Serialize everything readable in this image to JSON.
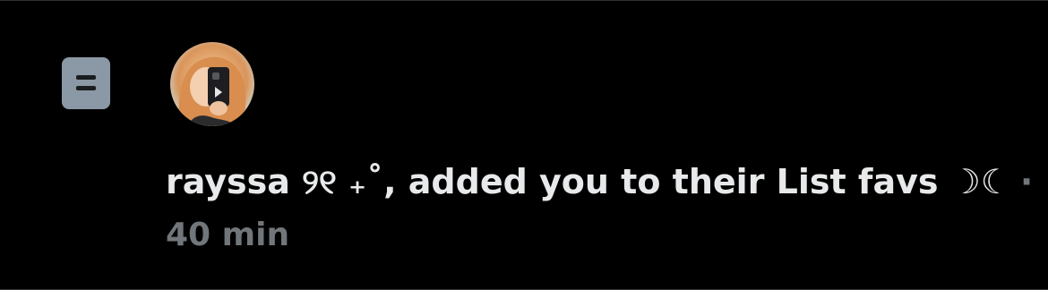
{
  "notification": {
    "icon": "list-icon",
    "user_name": "rayssa ୨୧ ₊˚",
    "action_text": ", added you to their List favs ☽☾",
    "separator": "·",
    "time": "40 min"
  },
  "colors": {
    "background": "#000000",
    "text_primary": "#e7e9ea",
    "text_secondary": "#71767b",
    "icon_bg": "#8b98a5",
    "divider": "#2f3336"
  }
}
